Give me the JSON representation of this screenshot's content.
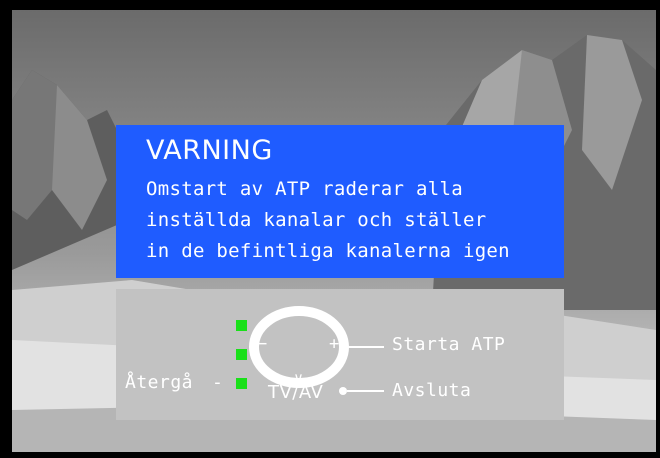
{
  "warning": {
    "title": "VARNING",
    "lines": [
      "Omstart av ATP raderar alla",
      "inställda kanalar och ställer",
      "in de befintliga kanalerna igen"
    ]
  },
  "controls": {
    "back_label": "Återgå",
    "back_dash": "-",
    "start_label": "Starta ATP",
    "tv_label": "TV/AV",
    "exit_label": "Avsluta",
    "dpad_up": "∧",
    "dpad_down": "∨",
    "dpad_left": "−",
    "dpad_right": "+"
  },
  "colors": {
    "warning_bg": "#1f5cff",
    "panel_bg": "#c2c2c2",
    "indicator": "#19e019"
  },
  "icons": {
    "navigation": "dpad-icon",
    "indicators": "green-square-icon"
  }
}
